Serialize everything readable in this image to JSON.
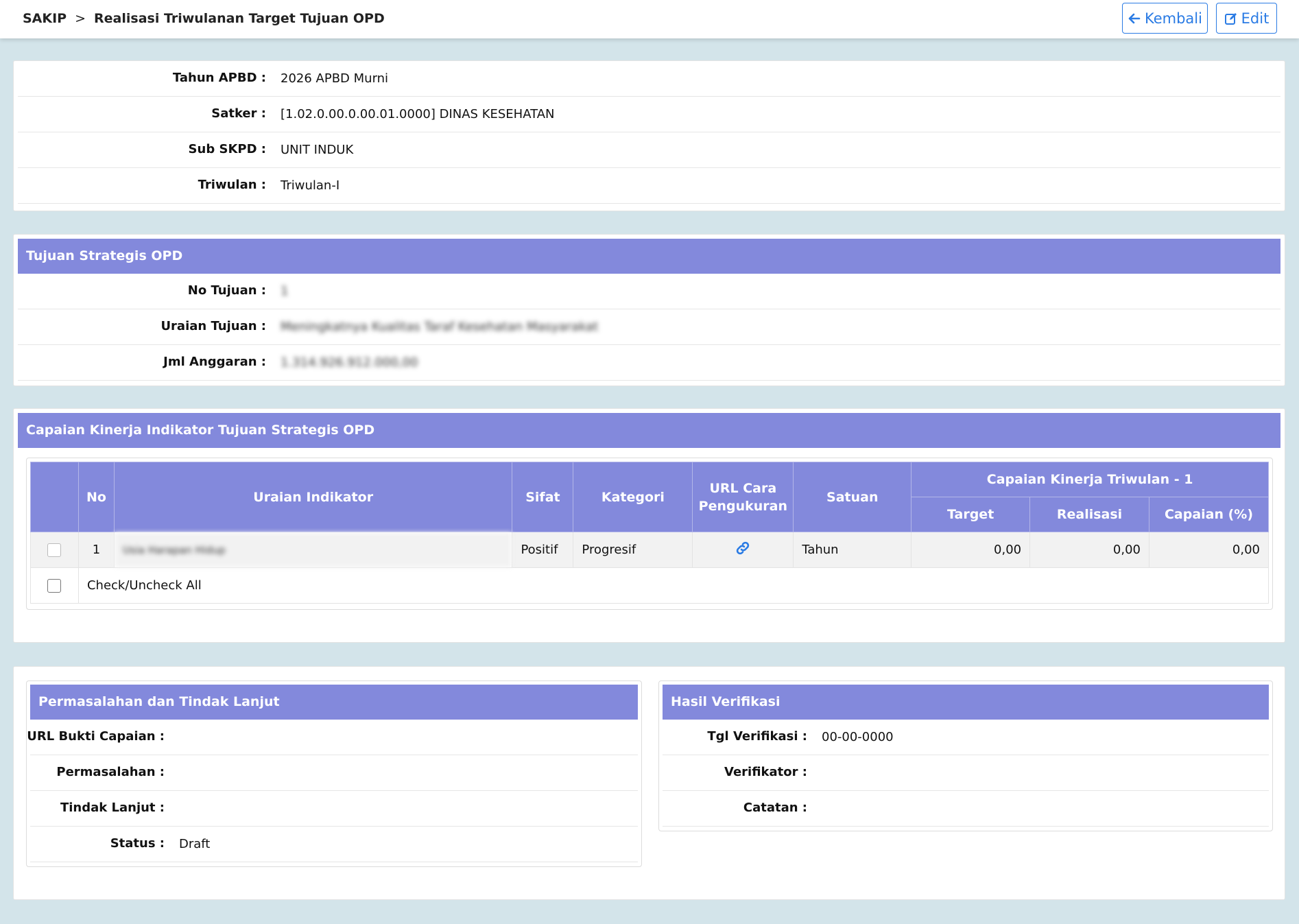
{
  "breadcrumb": {
    "root": "SAKIP",
    "separator": ">",
    "current": "Realisasi Triwulanan Target Tujuan OPD"
  },
  "buttons": {
    "back": "Kembali",
    "edit": "Edit"
  },
  "info": {
    "tahun_label": "Tahun APBD :",
    "tahun_value": "2026 APBD Murni",
    "satker_label": "Satker :",
    "satker_value": "[1.02.0.00.0.00.01.0000] DINAS KESEHATAN",
    "sub_label": "Sub SKPD :",
    "sub_value": "UNIT INDUK",
    "triwulan_label": "Triwulan :",
    "triwulan_value": "Triwulan-I"
  },
  "tujuan": {
    "title": "Tujuan Strategis OPD",
    "no_label": "No Tujuan :",
    "no_value": "1",
    "uraian_label": "Uraian Tujuan :",
    "uraian_value": "Meningkatnya Kualitas Taraf Kesehatan Masyarakat",
    "anggaran_label": "Jml Anggaran :",
    "anggaran_value": "1.314.926.912.000,00"
  },
  "capaian": {
    "title": "Capaian Kinerja Indikator Tujuan Strategis OPD",
    "headers": {
      "no": "No",
      "uraian": "Uraian Indikator",
      "sifat": "Sifat",
      "kategori": "Kategori",
      "url": "URL Cara Pengukuran",
      "satuan": "Satuan",
      "group": "Capaian Kinerja Triwulan - 1",
      "target": "Target",
      "realisasi": "Realisasi",
      "capaian": "Capaian (%)"
    },
    "rows": [
      {
        "no": "1",
        "uraian": "Usia Harapan Hidup",
        "sifat": "Positif",
        "kategori": "Progresif",
        "satuan": "Tahun",
        "target": "0,00",
        "realisasi": "0,00",
        "capaian": "0,00"
      }
    ],
    "check_all": "Check/Uncheck All"
  },
  "permasalahan": {
    "title": "Permasalahan dan Tindak Lanjut",
    "url_label": "URL Bukti Capaian :",
    "url_value": "",
    "masalah_label": "Permasalahan :",
    "masalah_value": "",
    "tindak_label": "Tindak Lanjut :",
    "tindak_value": "",
    "status_label": "Status :",
    "status_value": "Draft"
  },
  "verifikasi": {
    "title": "Hasil Verifikasi",
    "tgl_label": "Tgl Verifikasi :",
    "tgl_value": "00-00-0000",
    "verifikator_label": "Verifikator :",
    "verifikator_value": "",
    "catatan_label": "Catatan :",
    "catatan_value": ""
  },
  "colors": {
    "accent": "#2a7be4",
    "header_band": "#8389dc",
    "background": "#d3e4ea"
  },
  "icons": {
    "back": "arrow-left-icon",
    "edit": "edit-icon",
    "url": "link-icon"
  }
}
